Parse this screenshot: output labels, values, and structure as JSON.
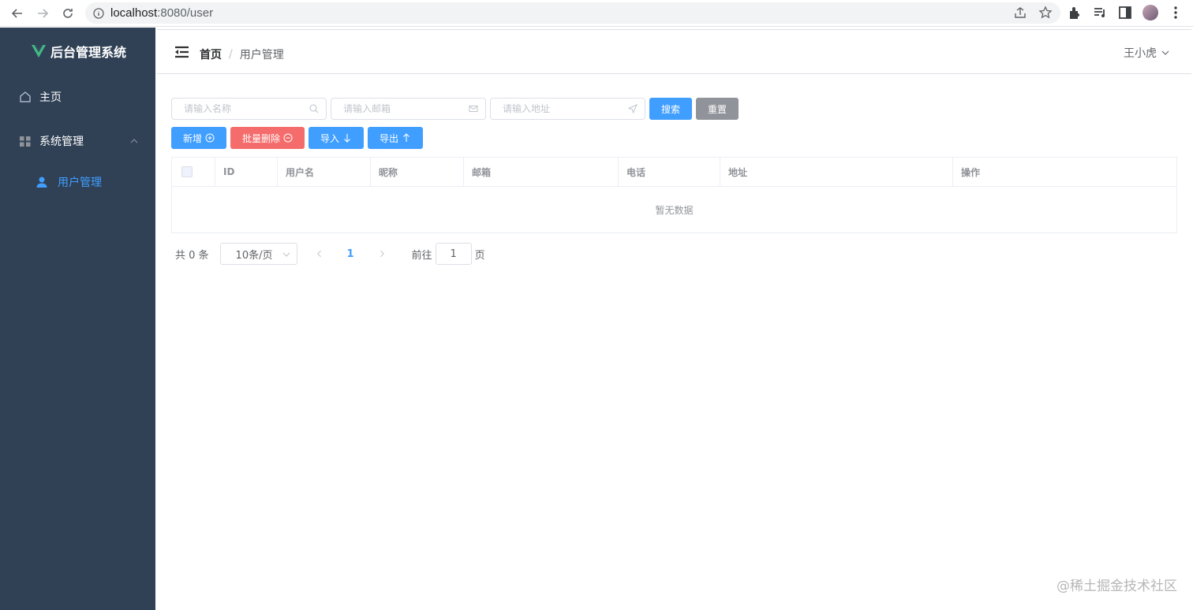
{
  "browser": {
    "url_host": "localhost",
    "url_rest": ":8080/user"
  },
  "sidebar": {
    "logo_text": "后台管理系统",
    "items": [
      {
        "label": "主页"
      },
      {
        "label": "系统管理"
      }
    ],
    "sub_items": [
      {
        "label": "用户管理"
      }
    ],
    "colors": {
      "background": "#304156",
      "active": "#409eff"
    }
  },
  "header": {
    "breadcrumb_home": "首页",
    "breadcrumb_sep": "/",
    "breadcrumb_current": "用户管理",
    "user_name": "王小虎"
  },
  "search": {
    "name_placeholder": "请输入名称",
    "email_placeholder": "请输入邮箱",
    "address_placeholder": "请输入地址",
    "search_label": "搜索",
    "reset_label": "重置"
  },
  "actions": {
    "add_label": "新增",
    "batch_delete_label": "批量删除",
    "import_label": "导入",
    "export_label": "导出"
  },
  "table": {
    "columns": [
      "ID",
      "用户名",
      "昵称",
      "邮箱",
      "电话",
      "地址",
      "操作"
    ],
    "empty_text": "暂无数据"
  },
  "pagination": {
    "total_text": "共 0 条",
    "page_size": "10条/页",
    "current_page": "1",
    "goto_prefix": "前往",
    "goto_value": "1",
    "goto_suffix": "页"
  },
  "watermark": "@稀土掘金技术社区"
}
